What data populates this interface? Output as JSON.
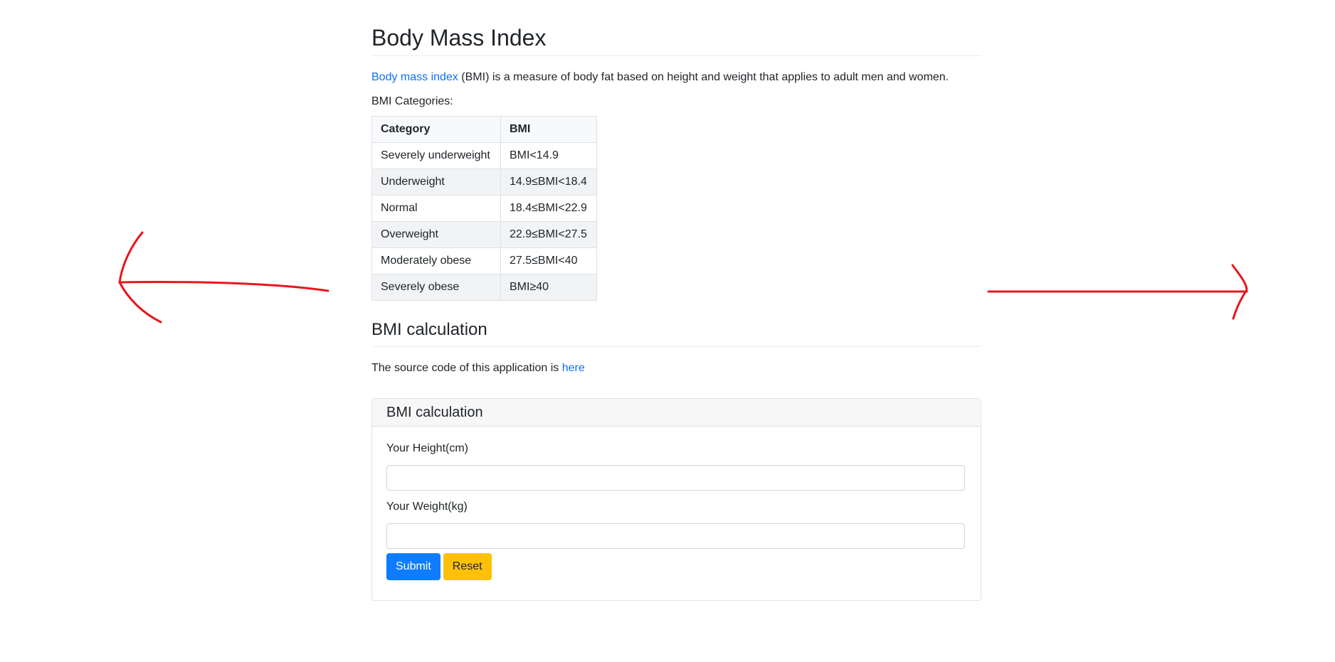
{
  "page": {
    "title": "Body Mass Index",
    "intro_link": "Body mass index",
    "intro_text": " (BMI) is a measure of body fat based on height and weight that applies to adult men and women.",
    "categories_label": "BMI Categories:"
  },
  "table": {
    "headers": [
      "Category",
      "BMI"
    ],
    "rows": [
      [
        "Severely underweight",
        "BMI<14.9"
      ],
      [
        "Underweight",
        "14.9≤BMI<18.4"
      ],
      [
        "Normal",
        "18.4≤BMI<22.9"
      ],
      [
        "Overweight",
        "22.9≤BMI<27.5"
      ],
      [
        "Moderately obese",
        "27.5≤BMI<40"
      ],
      [
        "Severely obese",
        "BMI≥40"
      ]
    ]
  },
  "calc_section": {
    "title": "BMI calculation",
    "source_text": "The source code of this application is ",
    "source_link": "here"
  },
  "form": {
    "title": "BMI calculation",
    "height_label": "Your Height(cm)",
    "height_value": "",
    "weight_label": "Your Weight(kg)",
    "weight_value": "",
    "submit_label": "Submit",
    "reset_label": "Reset"
  },
  "annotations": {
    "left_arrow_icon": "arrow-left-icon",
    "right_arrow_icon": "arrow-right-icon",
    "color": "#e8161c"
  },
  "colors": {
    "link": "#0d6efd",
    "primary": "#0d7cff",
    "warning": "#ffc107"
  }
}
